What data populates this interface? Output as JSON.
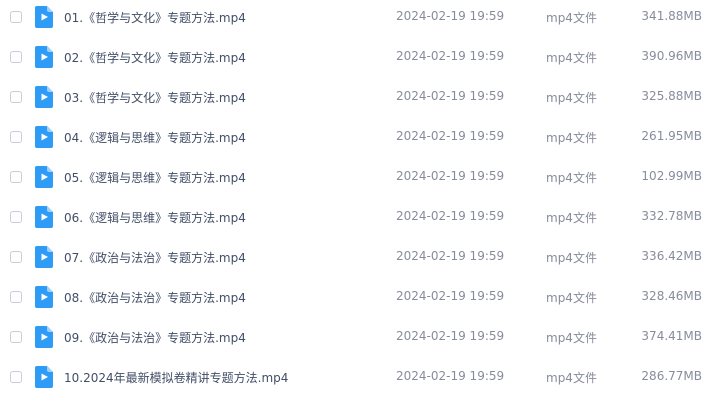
{
  "colors": {
    "icon_blue": "#2e9bf7",
    "icon_fold": "#9fd0fb",
    "text_primary": "#424e67",
    "text_secondary": "#878c9c"
  },
  "icons": {
    "file": "video-file-icon",
    "checkbox": "checkbox"
  },
  "files": [
    {
      "name": "01.《哲学与文化》专题方法.mp4",
      "date": "2024-02-19 19:59",
      "type": "mp4文件",
      "size": "341.88MB"
    },
    {
      "name": "02.《哲学与文化》专题方法.mp4",
      "date": "2024-02-19 19:59",
      "type": "mp4文件",
      "size": "390.96MB"
    },
    {
      "name": "03.《哲学与文化》专题方法.mp4",
      "date": "2024-02-19 19:59",
      "type": "mp4文件",
      "size": "325.88MB"
    },
    {
      "name": "04.《逻辑与思维》专题方法.mp4",
      "date": "2024-02-19 19:59",
      "type": "mp4文件",
      "size": "261.95MB"
    },
    {
      "name": "05.《逻辑与思维》专题方法.mp4",
      "date": "2024-02-19 19:59",
      "type": "mp4文件",
      "size": "102.99MB"
    },
    {
      "name": "06.《逻辑与思维》专题方法.mp4",
      "date": "2024-02-19 19:59",
      "type": "mp4文件",
      "size": "332.78MB"
    },
    {
      "name": "07.《政治与法治》专题方法.mp4",
      "date": "2024-02-19 19:59",
      "type": "mp4文件",
      "size": "336.42MB"
    },
    {
      "name": "08.《政治与法治》专题方法.mp4",
      "date": "2024-02-19 19:59",
      "type": "mp4文件",
      "size": "328.46MB"
    },
    {
      "name": "09.《政治与法治》专题方法.mp4",
      "date": "2024-02-19 19:59",
      "type": "mp4文件",
      "size": "374.41MB"
    },
    {
      "name": "10.2024年最新模拟卷精讲专题方法.mp4",
      "date": "2024-02-19 19:59",
      "type": "mp4文件",
      "size": "286.77MB"
    }
  ]
}
